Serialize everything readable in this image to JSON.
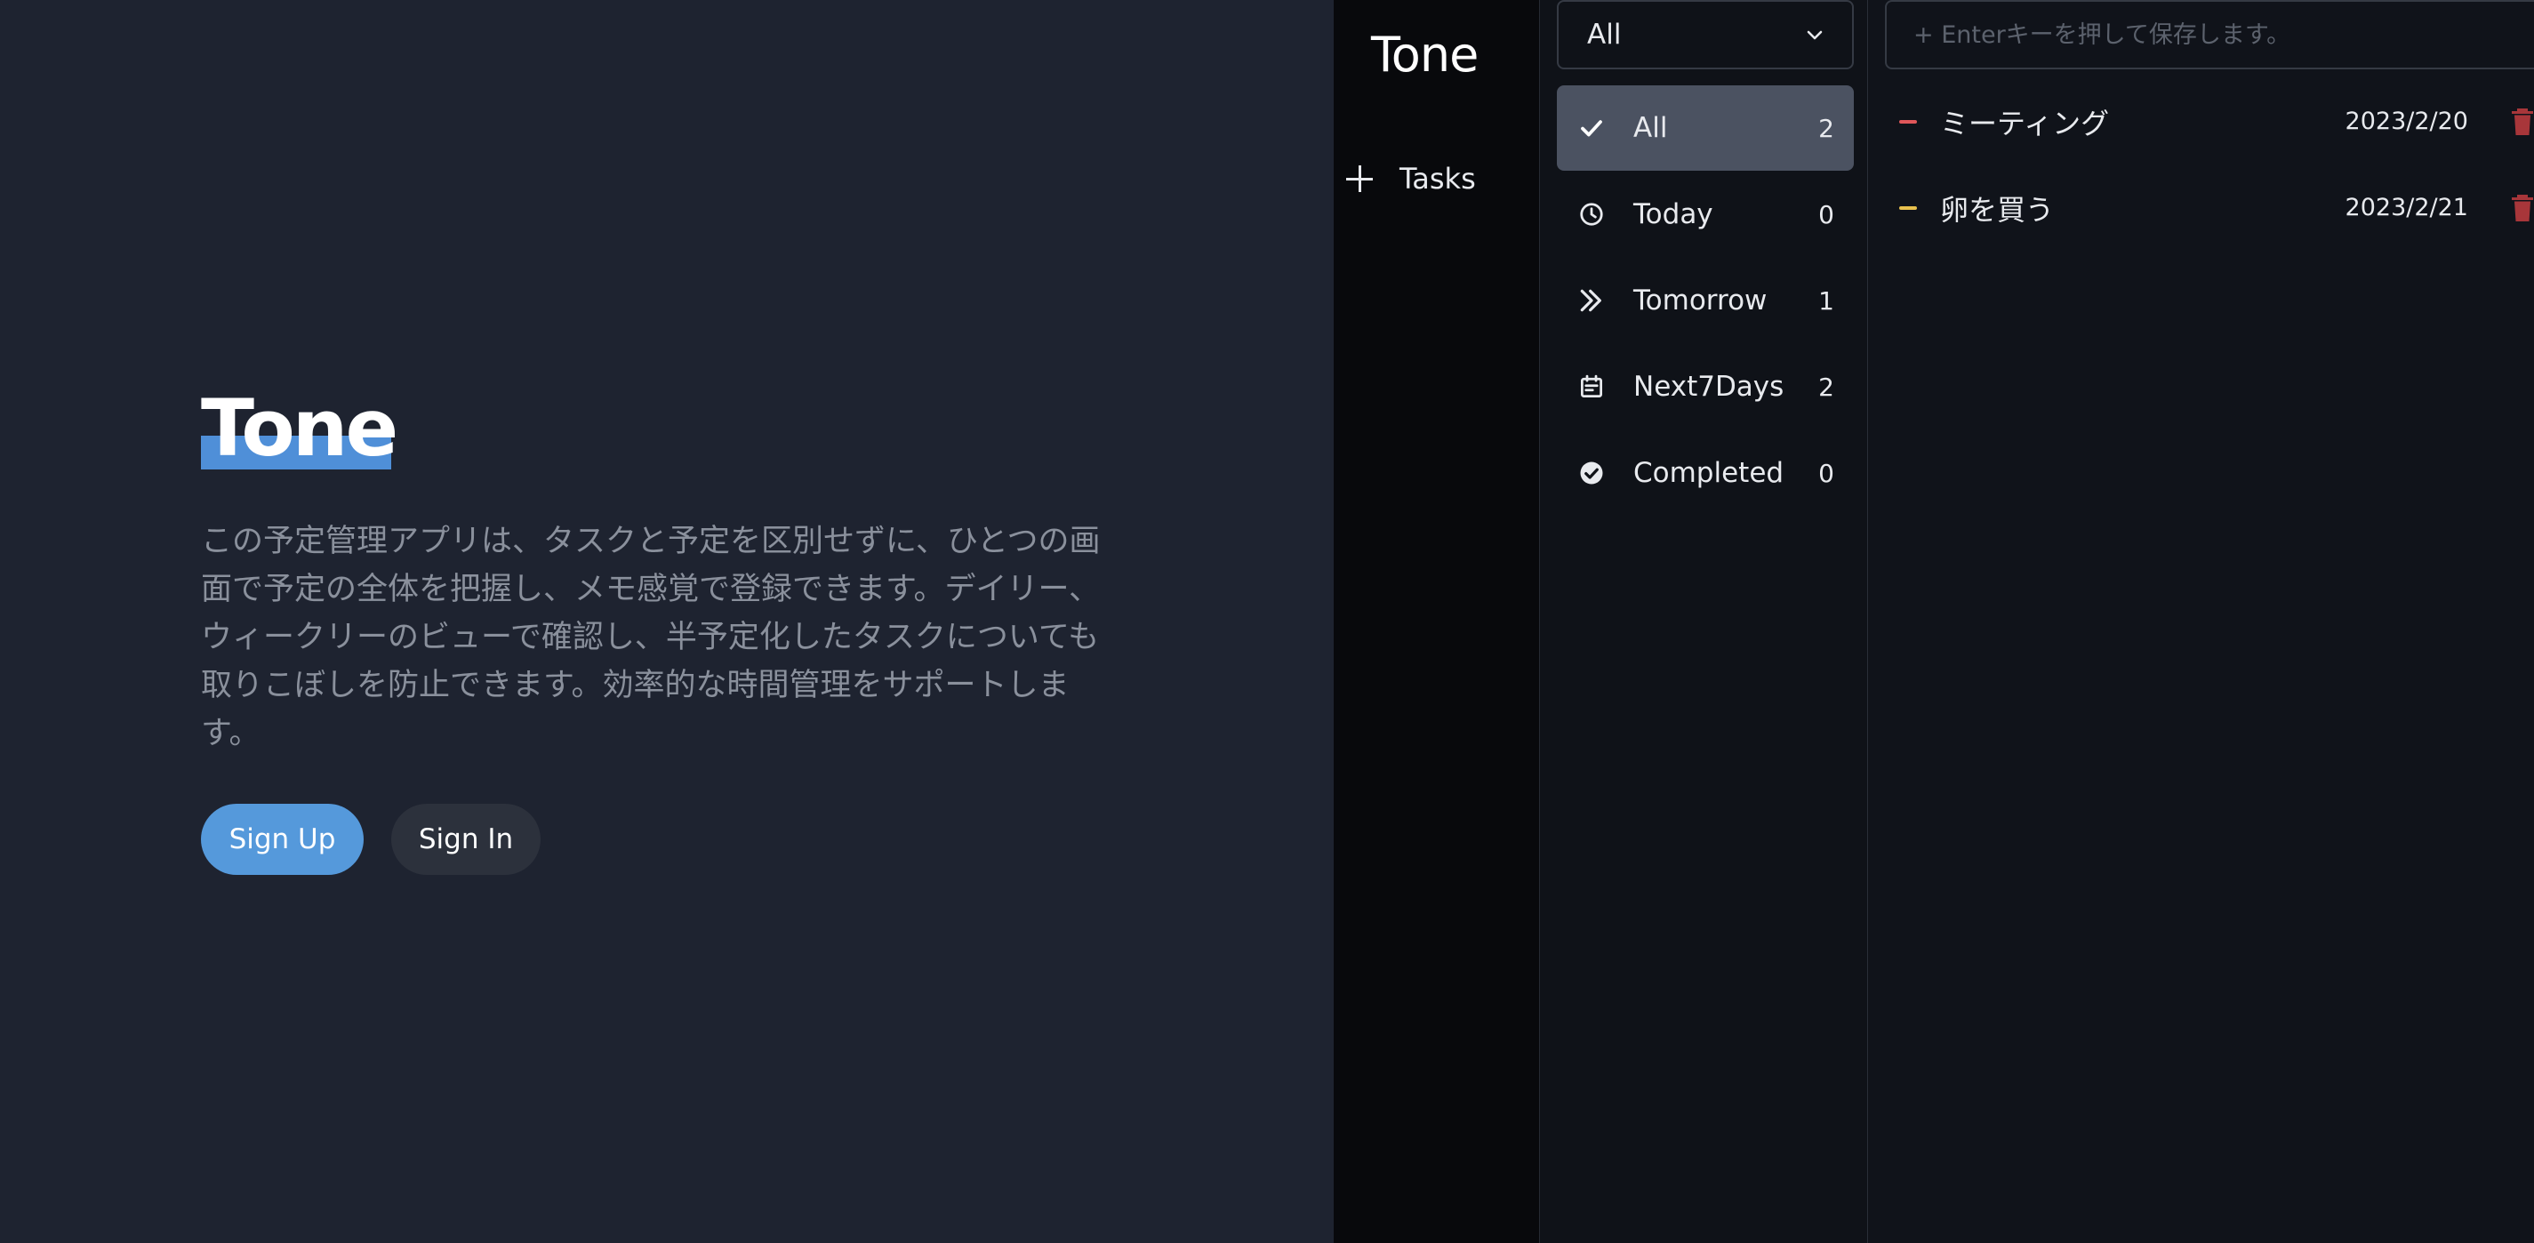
{
  "landing": {
    "title": "Tone",
    "description": "この予定管理アプリは、タスクと予定を区別せずに、ひとつの画面で予定の全体を把握し、メモ感覚で登録できます。デイリー、ウィークリーのビューで確認し、半予定化したタスクについても取りこぼしを防止できます。効率的な時間管理をサポートします。",
    "signup_label": "Sign Up",
    "signin_label": "Sign In",
    "accent_color": "#5599db"
  },
  "app": {
    "logo": "Tone",
    "nav_tasks_label": "Tasks",
    "filter_select_value": "All",
    "filters": [
      {
        "label": "All",
        "count": "2",
        "icon": "check-icon",
        "active": true
      },
      {
        "label": "Today",
        "count": "0",
        "icon": "clock-icon",
        "active": false
      },
      {
        "label": "Tomorrow",
        "count": "1",
        "icon": "double-chevron-right-icon",
        "active": false
      },
      {
        "label": "Next7Days",
        "count": "2",
        "icon": "calendar-icon",
        "active": false
      },
      {
        "label": "Completed",
        "count": "0",
        "icon": "check-circle-icon",
        "active": false
      }
    ],
    "task_input_placeholder": "+ Enterキーを押して保存します。",
    "tasks": [
      {
        "title": "ミーティング",
        "date": "2023/2/20",
        "priority_color": "#e0575a"
      },
      {
        "title": "卵を買う",
        "date": "2023/2/21",
        "priority_color": "#e8c14e"
      }
    ],
    "delete_color": "#a8363a"
  }
}
